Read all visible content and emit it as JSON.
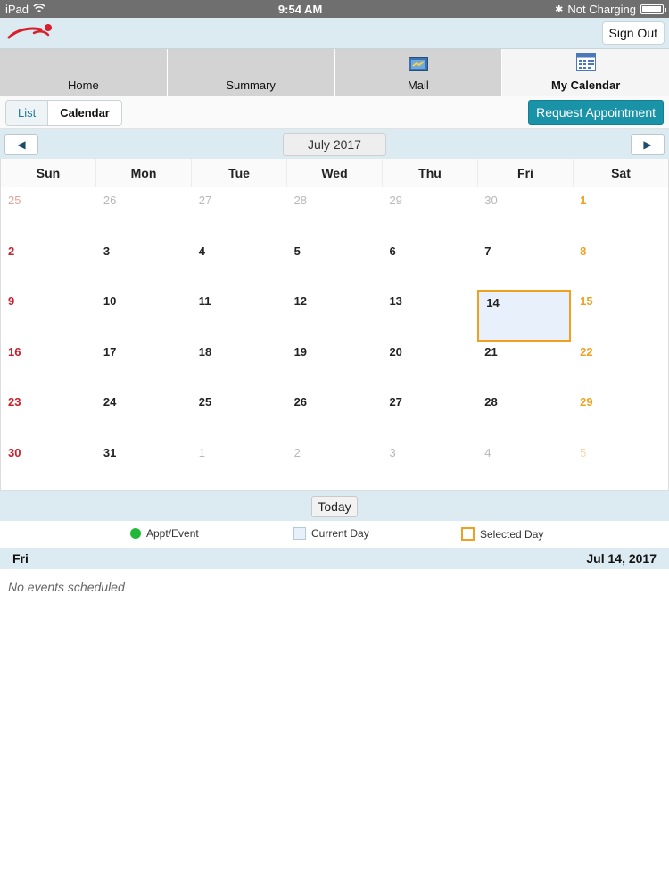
{
  "status_bar": {
    "device": "iPad",
    "time": "9:54 AM",
    "charging": "Not Charging",
    "battery_level": 0.95
  },
  "header": {
    "sign_out_label": "Sign Out"
  },
  "tabs": [
    {
      "label": "Home",
      "icon": "none"
    },
    {
      "label": "Summary",
      "icon": "none"
    },
    {
      "label": "Mail",
      "icon": "mail-icon"
    },
    {
      "label": "My Calendar",
      "icon": "calendar-icon",
      "active": true
    }
  ],
  "view_toggle": {
    "list_label": "List",
    "calendar_label": "Calendar",
    "selected": "Calendar"
  },
  "request_button_label": "Request Appointment",
  "month_nav": {
    "label": "July 2017",
    "prev_icon": "triangle-left-icon",
    "next_icon": "triangle-right-icon"
  },
  "calendar": {
    "weekdays": [
      "Sun",
      "Mon",
      "Tue",
      "Wed",
      "Thu",
      "Fri",
      "Sat"
    ],
    "weeks": [
      [
        "25",
        "26",
        "27",
        "28",
        "29",
        "30",
        "1"
      ],
      [
        "2",
        "3",
        "4",
        "5",
        "6",
        "7",
        "8"
      ],
      [
        "9",
        "10",
        "11",
        "12",
        "13",
        "14",
        "15"
      ],
      [
        "16",
        "17",
        "18",
        "19",
        "20",
        "21",
        "22"
      ],
      [
        "23",
        "24",
        "25",
        "26",
        "27",
        "28",
        "29"
      ],
      [
        "30",
        "31",
        "1",
        "2",
        "3",
        "4",
        "5"
      ]
    ],
    "selected_day": "14",
    "colors": {
      "sunday": "#c6202c",
      "saturday": "#f0a020",
      "selected_border": "#f0a020",
      "current_day_fill": "#e8f0fb",
      "event_dot": "#1fb838",
      "accent": "#1a92a8"
    }
  },
  "today_button_label": "Today",
  "legend": {
    "appt_label": "Appt/Event",
    "current_label": "Current Day",
    "selected_label": "Selected Day"
  },
  "day_detail": {
    "weekday": "Fri",
    "date": "Jul 14, 2017",
    "empty_message": "No events scheduled"
  }
}
